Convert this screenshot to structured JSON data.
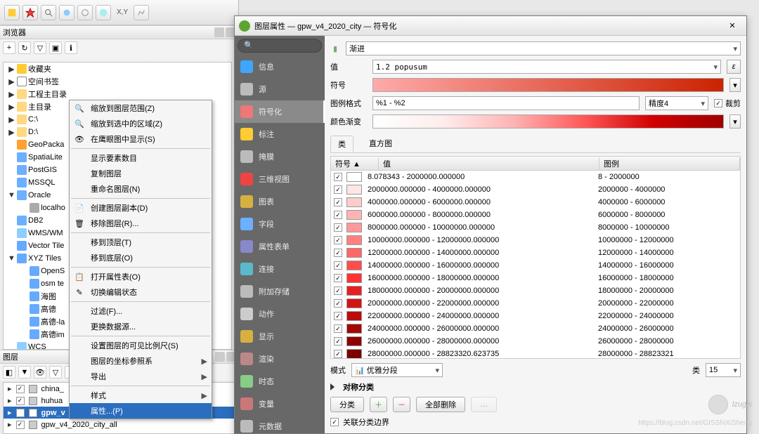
{
  "toolbar_xy_label": "X,Y",
  "browser_panel_title": "浏览器",
  "browser_tree": [
    {
      "exp": "▶",
      "icon": "i-star",
      "label": "收藏夹",
      "indent": 0
    },
    {
      "exp": "▶",
      "icon": "i-file",
      "label": "空间书签",
      "indent": 0
    },
    {
      "exp": "▶",
      "icon": "i-folder",
      "label": "工程主目录",
      "indent": 0
    },
    {
      "exp": "▶",
      "icon": "i-folder",
      "label": "主目录",
      "indent": 0
    },
    {
      "exp": "▶",
      "icon": "i-folder",
      "label": "C:\\",
      "indent": 0
    },
    {
      "exp": "▶",
      "icon": "i-folder",
      "label": "D:\\",
      "indent": 0
    },
    {
      "exp": "",
      "icon": "i-gp",
      "label": "GeoPacka",
      "indent": 0
    },
    {
      "exp": "",
      "icon": "i-db",
      "label": "SpatiaLite",
      "indent": 0
    },
    {
      "exp": "",
      "icon": "i-db",
      "label": "PostGIS",
      "indent": 0
    },
    {
      "exp": "",
      "icon": "i-db",
      "label": "MSSQL",
      "indent": 0
    },
    {
      "exp": "▼",
      "icon": "i-db",
      "label": "Oracle",
      "indent": 0
    },
    {
      "exp": "",
      "icon": "i-dot",
      "label": "localho",
      "indent": 1
    },
    {
      "exp": "",
      "icon": "i-db",
      "label": "DB2",
      "indent": 0
    },
    {
      "exp": "",
      "icon": "i-globe",
      "label": "WMS/WM",
      "indent": 0
    },
    {
      "exp": "",
      "icon": "i-grid",
      "label": "Vector Tile",
      "indent": 0
    },
    {
      "exp": "▼",
      "icon": "i-grid",
      "label": "XYZ Tiles",
      "indent": 0
    },
    {
      "exp": "",
      "icon": "i-grid",
      "label": "OpenS",
      "indent": 1
    },
    {
      "exp": "",
      "icon": "i-grid",
      "label": "osm te",
      "indent": 1
    },
    {
      "exp": "",
      "icon": "i-grid",
      "label": "海图",
      "indent": 1
    },
    {
      "exp": "",
      "icon": "i-grid",
      "label": "高德",
      "indent": 1
    },
    {
      "exp": "",
      "icon": "i-grid",
      "label": "高德-la",
      "indent": 1
    },
    {
      "exp": "",
      "icon": "i-grid",
      "label": "高德im",
      "indent": 1
    },
    {
      "exp": "",
      "icon": "i-globe",
      "label": "WCS",
      "indent": 0
    }
  ],
  "layers_panel_title": "图层",
  "layers": [
    {
      "checked": true,
      "label": "china_",
      "sel": false
    },
    {
      "checked": true,
      "label": "huhua",
      "sel": false
    },
    {
      "checked": true,
      "label": "gpw_v",
      "sel": true
    },
    {
      "checked": true,
      "label": "gpw_v4_2020_city_all",
      "sel": false
    }
  ],
  "context_menu": [
    {
      "icon": "🔍",
      "label": "缩放到图层范围(Z)"
    },
    {
      "icon": "🔍",
      "label": "缩放到选中的区域(Z)"
    },
    {
      "icon": "👁",
      "label": "在鹰眼图中显示(S)"
    },
    {
      "sep": true
    },
    {
      "icon": "",
      "label": "显示要素数目"
    },
    {
      "icon": "",
      "label": "复制图层"
    },
    {
      "icon": "",
      "label": "重命名图层(N)"
    },
    {
      "sep": true
    },
    {
      "icon": "📄",
      "label": "创建图层副本(D)"
    },
    {
      "icon": "🗑",
      "label": "移除图层(R)..."
    },
    {
      "sep": true
    },
    {
      "icon": "",
      "label": "移到顶层(T)"
    },
    {
      "icon": "",
      "label": "移到底层(O)"
    },
    {
      "sep": true
    },
    {
      "icon": "📋",
      "label": "打开属性表(O)"
    },
    {
      "icon": "✎",
      "label": "切换编辑状态"
    },
    {
      "sep": true
    },
    {
      "icon": "",
      "label": "过滤(F)..."
    },
    {
      "icon": "",
      "label": "更换数据源..."
    },
    {
      "sep": true
    },
    {
      "icon": "",
      "label": "设置图层的可见比例尺(S)"
    },
    {
      "icon": "",
      "label": "图层的坐标参照系",
      "sub": true
    },
    {
      "icon": "",
      "label": "导出",
      "sub": true
    },
    {
      "sep": true
    },
    {
      "icon": "",
      "label": "样式",
      "sub": true
    },
    {
      "icon": "",
      "label": "属性...(P)",
      "hi": true
    }
  ],
  "dialog_title": "图层属性 — gpw_v4_2020_city — 符号化",
  "side_items": [
    {
      "cls": "si-info",
      "label": "信息"
    },
    {
      "cls": "si-wrench",
      "label": "源"
    },
    {
      "cls": "si-brush",
      "label": "符号化",
      "sel": true
    },
    {
      "cls": "si-abc",
      "label": "标注"
    },
    {
      "cls": "si-mask",
      "label": "掩膜"
    },
    {
      "cls": "si-3d",
      "label": "三维视图"
    },
    {
      "cls": "si-chart",
      "label": "图表"
    },
    {
      "cls": "si-field",
      "label": "字段"
    },
    {
      "cls": "si-form",
      "label": "属性表单"
    },
    {
      "cls": "si-conn",
      "label": "连接"
    },
    {
      "cls": "si-attach",
      "label": "附加存储"
    },
    {
      "cls": "si-act",
      "label": "动作"
    },
    {
      "cls": "si-disp",
      "label": "显示"
    },
    {
      "cls": "si-render",
      "label": "渲染"
    },
    {
      "cls": "si-time",
      "label": "时态"
    },
    {
      "cls": "si-var",
      "label": "变量"
    },
    {
      "cls": "si-meta",
      "label": "元数据"
    }
  ],
  "renderer_type": "渐进",
  "value_label": "值",
  "value_field": "1.2 popusum",
  "eps_label": "ε",
  "symbol_label": "符号",
  "legendfmt_label": "图例格式",
  "legendfmt_value": "%1 - %2",
  "precision_label": "精度4",
  "trim_label": "裁剪",
  "ramp_label": "颜色渐变",
  "tab_classes": "类",
  "tab_hist": "直方图",
  "table_headers": {
    "sym": "符号 ▲",
    "val": "值",
    "leg": "图例"
  },
  "classes": [
    {
      "c": "#ffffff",
      "val": "8.078343 - 2000000.000000",
      "leg": "8 - 2000000"
    },
    {
      "c": "#ffe6e6",
      "val": "2000000.000000 - 4000000.000000",
      "leg": "2000000 - 4000000"
    },
    {
      "c": "#ffcccc",
      "val": "4000000.000000 - 6000000.000000",
      "leg": "4000000 - 6000000"
    },
    {
      "c": "#ffb3b3",
      "val": "6000000.000000 - 8000000.000000",
      "leg": "6000000 - 8000000"
    },
    {
      "c": "#ff9999",
      "val": "8000000.000000 - 10000000.000000",
      "leg": "8000000 - 10000000"
    },
    {
      "c": "#ff8080",
      "val": "10000000.000000 - 12000000.000000",
      "leg": "10000000 - 12000000"
    },
    {
      "c": "#ff6666",
      "val": "12000000.000000 - 14000000.000000",
      "leg": "12000000 - 14000000"
    },
    {
      "c": "#ff4d4d",
      "val": "14000000.000000 - 16000000.000000",
      "leg": "14000000 - 16000000"
    },
    {
      "c": "#ff3333",
      "val": "16000000.000000 - 18000000.000000",
      "leg": "16000000 - 18000000"
    },
    {
      "c": "#e62020",
      "val": "18000000.000000 - 20000000.000000",
      "leg": "18000000 - 20000000"
    },
    {
      "c": "#d11515",
      "val": "20000000.000000 - 22000000.000000",
      "leg": "20000000 - 22000000"
    },
    {
      "c": "#bb0c0c",
      "val": "22000000.000000 - 24000000.000000",
      "leg": "22000000 - 24000000"
    },
    {
      "c": "#a50606",
      "val": "24000000.000000 - 26000000.000000",
      "leg": "24000000 - 26000000"
    },
    {
      "c": "#900202",
      "val": "26000000.000000 - 28000000.000000",
      "leg": "26000000 - 28000000"
    },
    {
      "c": "#7a0000",
      "val": "28000000.000000 - 28823320.623735",
      "leg": "28000000 - 28823321"
    }
  ],
  "mode_label": "模式",
  "mode_value": "优雅分段",
  "classes_count_label": "类",
  "classes_count": "15",
  "sym_classify_label": "对称分类",
  "btn_classify": "分类",
  "btn_delete_all": "全部删除",
  "chk_link": "关联分类边界",
  "watermark": "lzugis",
  "csdn_watermark": "https://blog.csdn.net/GISShiXiSheng"
}
